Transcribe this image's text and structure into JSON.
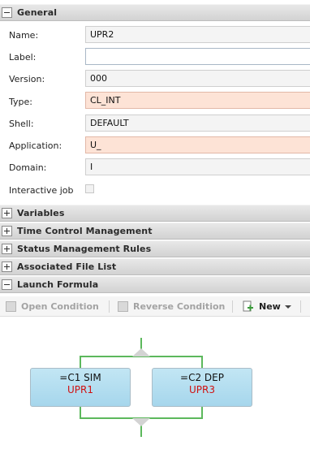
{
  "sections": {
    "general": "General",
    "variables": "Variables",
    "time_control": "Time Control Management",
    "status_rules": "Status Management Rules",
    "file_list": "Associated File List",
    "launch_formula": "Launch Formula"
  },
  "fields": {
    "name": {
      "label": "Name:",
      "value": "UPR2"
    },
    "label": {
      "label": "Label:",
      "value": ""
    },
    "version": {
      "label": "Version:",
      "value": "000"
    },
    "type": {
      "label": "Type:",
      "value": "CL_INT"
    },
    "shell": {
      "label": "Shell:",
      "value": "DEFAULT"
    },
    "application": {
      "label": "Application:",
      "value": "U_"
    },
    "domain": {
      "label": "Domain:",
      "value": "I"
    },
    "interactive_job": {
      "label": "Interactive job",
      "checked": false
    }
  },
  "toolbar": {
    "open_condition": "Open Condition",
    "reverse_condition": "Reverse Condition",
    "new": "New"
  },
  "formula": {
    "node1": {
      "condition": "=C1 SIM",
      "job": "UPR1"
    },
    "node2": {
      "condition": "=C2 DEP",
      "job": "UPR3"
    }
  },
  "colors": {
    "highlight_field": "#fde3d6",
    "connector_green": "#5cb85c",
    "node_fill": "#b5def0",
    "job_red": "#d01010"
  }
}
